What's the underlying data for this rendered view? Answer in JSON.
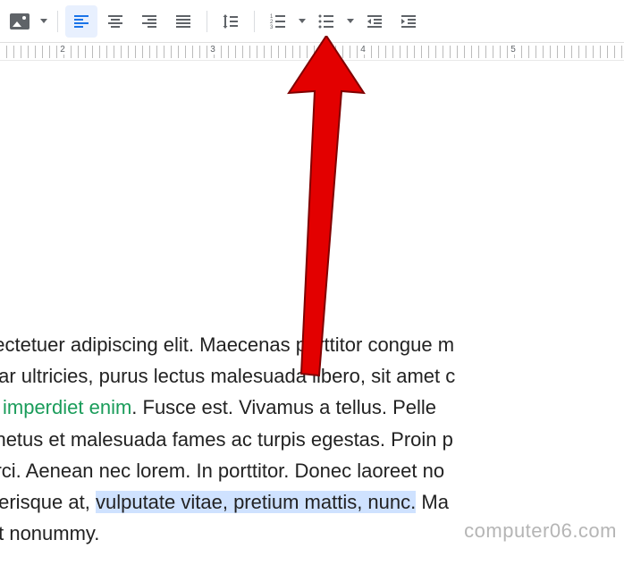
{
  "toolbar": {
    "insertImage": "Insert image",
    "alignLeft": "Align left",
    "alignCenter": "Align center",
    "alignRight": "Align right",
    "alignJustify": "Justify",
    "lineSpacing": "Line spacing",
    "numberedList": "Numbered list",
    "bulletedList": "Bulleted list",
    "decreaseIndent": "Decrease indent",
    "increaseIndent": "Increase indent"
  },
  "ruler": {
    "labels": [
      "2",
      "3",
      "4",
      "5"
    ]
  },
  "document": {
    "lines": [
      {
        "plain": "nsectetuer adipiscing elit. Maecenas porttitor congue m"
      },
      {
        "plain": "vinar ultricies, purus lectus malesuada libero, sit amet c"
      },
      {
        "link": "rra imperdiet enim",
        "after": ". Fusce est. Vivamus a tellus. Pelle"
      },
      {
        "plain": "et netus et malesuada fames ac turpis egestas. Proin p"
      },
      {
        "plain": "t orci. Aenean nec lorem. In porttitor. Donec laoreet no"
      },
      {
        "plain_before": "celerisque at, ",
        "highlight": "vulputate vitae, pretium mattis, nunc.",
        "plain_after": " Ma"
      },
      {
        "plain": ". Ut nonummy."
      }
    ]
  },
  "watermark": "computer06.com",
  "colors": {
    "activeBg": "#e8f0fe",
    "activeFg": "#1a73e8",
    "link": "#1a9c5a",
    "highlight": "#cfe2ff",
    "arrow": "#e30000"
  }
}
